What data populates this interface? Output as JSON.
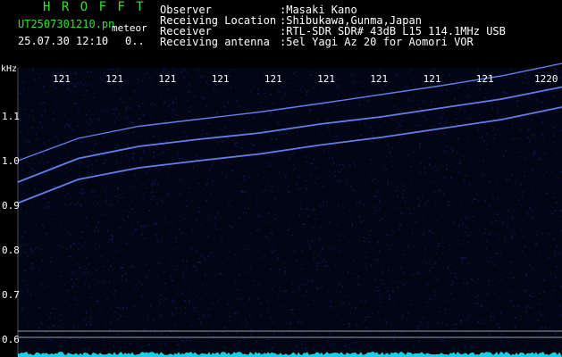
{
  "app": {
    "logo": "H R O F F T",
    "filename": "UT2507301210.pn",
    "mode": "meteor",
    "timestamp": "25.07.30 12:10",
    "counter": "0.."
  },
  "info": {
    "labels": [
      "Observer",
      "Receiving Location",
      "Receiver",
      "Receiving antenna"
    ],
    "values": [
      ":Masaki Kano",
      ":Shibukawa,Gunma,Japan",
      ":RTL-SDR SDR# 43dB L15 114.1MHz USB",
      ":5el Yagi Az 20 for Aomori VOR"
    ]
  },
  "chart_data": {
    "type": "heatmap",
    "ylabel": "kHz",
    "y_ticks": [
      "1.1",
      "1.0",
      "0.9",
      "0.8",
      "0.7",
      "0.6"
    ],
    "time_ticks": [
      "121",
      "121",
      "121",
      "121",
      "121",
      "121",
      "121",
      "121",
      "121",
      "1220"
    ],
    "ylim": [
      0.6,
      1.15
    ],
    "traces": [
      {
        "x": [
          0,
          1,
          2,
          3,
          4,
          5,
          6,
          7,
          8,
          9
        ],
        "y": [
          0.952,
          1.005,
          1.032,
          1.048,
          1.062,
          1.082,
          1.098,
          1.118,
          1.138,
          1.165
        ]
      },
      {
        "x": [
          0,
          1,
          2,
          3,
          4,
          5,
          6,
          7,
          8,
          9
        ],
        "y": [
          1.0,
          1.05,
          1.077,
          1.093,
          1.109,
          1.128,
          1.148,
          1.168,
          1.19,
          1.218
        ]
      },
      {
        "x": [
          0,
          1,
          2,
          3,
          4,
          5,
          6,
          7,
          8,
          9
        ],
        "y": [
          0.905,
          0.958,
          0.984,
          1.0,
          1.015,
          1.035,
          1.052,
          1.072,
          1.092,
          1.12
        ]
      }
    ],
    "reference_lines": [
      0.618,
      0.604
    ],
    "colors": {
      "background": "#000000",
      "noise": "#12207a",
      "trace": "#6b8cff",
      "grid": "#ffffff",
      "floor": "#19e6ff"
    }
  }
}
